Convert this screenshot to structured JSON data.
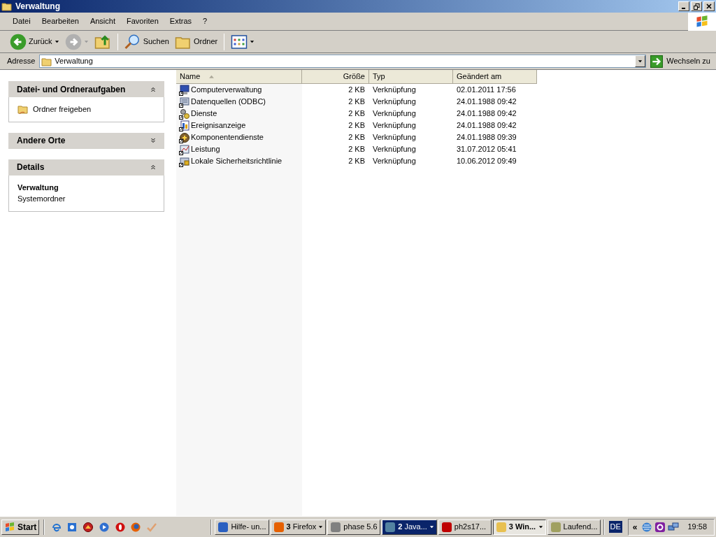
{
  "window": {
    "title": "Verwaltung"
  },
  "menu": [
    "Datei",
    "Bearbeiten",
    "Ansicht",
    "Favoriten",
    "Extras",
    "?"
  ],
  "toolbar": [
    {
      "kind": "back",
      "label": "Zurück",
      "disabled": false
    },
    {
      "kind": "forward",
      "disabled": true
    },
    {
      "kind": "up",
      "disabled": false
    },
    {
      "kind": "search",
      "label": "Suchen",
      "disabled": false
    },
    {
      "kind": "folders",
      "label": "Ordner",
      "disabled": false
    },
    {
      "kind": "views",
      "disabled": false
    }
  ],
  "address": {
    "label": "Adresse",
    "value": "Verwaltung",
    "go": "Wechseln zu"
  },
  "panels": [
    {
      "title": "Datei- und Ordneraufgaben",
      "expanded": true,
      "items": [
        {
          "kind": "task",
          "text": "Ordner freigeben"
        }
      ]
    },
    {
      "title": "Andere Orte",
      "expanded": false
    },
    {
      "title": "Details",
      "expanded": true,
      "items": [
        {
          "kind": "bold",
          "text": "Verwaltung"
        },
        {
          "kind": "plain",
          "text": "Systemordner"
        }
      ]
    }
  ],
  "table": {
    "columns": [
      {
        "label": "Name",
        "sorted": true
      },
      {
        "label": "Größe",
        "sorted": false
      },
      {
        "label": "Typ",
        "sorted": false
      },
      {
        "label": "Geändert am",
        "sorted": false
      }
    ],
    "rows": [
      {
        "name": "Computerverwaltung",
        "size": "2 KB",
        "type": "Verknüpfung",
        "modified": "02.01.2011 17:56"
      },
      {
        "name": "Datenquellen (ODBC)",
        "size": "2 KB",
        "type": "Verknüpfung",
        "modified": "24.01.1988 09:42"
      },
      {
        "name": "Dienste",
        "size": "2 KB",
        "type": "Verknüpfung",
        "modified": "24.01.1988 09:42"
      },
      {
        "name": "Ereignisanzeige",
        "size": "2 KB",
        "type": "Verknüpfung",
        "modified": "24.01.1988 09:42"
      },
      {
        "name": "Komponentendienste",
        "size": "2 KB",
        "type": "Verknüpfung",
        "modified": "24.01.1988 09:39"
      },
      {
        "name": "Leistung",
        "size": "2 KB",
        "type": "Verknüpfung",
        "modified": "31.07.2012 05:41"
      },
      {
        "name": "Lokale Sicherheitsrichtlinie",
        "size": "2 KB",
        "type": "Verknüpfung",
        "modified": "10.06.2012 09:49"
      }
    ]
  },
  "taskbar": {
    "start": "Start",
    "buttons": [
      {
        "label": "Hilfe- un...",
        "group": false,
        "selected": false,
        "flashing": false,
        "color": "#2a5fc0"
      },
      {
        "count": "3",
        "label": "Firefox",
        "group": true,
        "selected": false,
        "flashing": false,
        "color": "#e66000"
      },
      {
        "label": "phase 5.6",
        "group": false,
        "selected": false,
        "flashing": false,
        "color": "#808080"
      },
      {
        "count": "2",
        "label": "Java...",
        "group": true,
        "selected": false,
        "flashing": true,
        "color": "#5382a1"
      },
      {
        "label": "ph2s17...",
        "group": false,
        "selected": false,
        "flashing": false,
        "color": "#bf0000"
      },
      {
        "count": "3",
        "label": "Win...",
        "group": true,
        "selected": true,
        "flashing": false,
        "color": "#e8c050"
      },
      {
        "label": "Laufend...",
        "group": false,
        "selected": false,
        "flashing": false,
        "color": "#a0a060"
      }
    ],
    "language": "DE",
    "tray_toggle": "«",
    "clock": "19:58"
  }
}
